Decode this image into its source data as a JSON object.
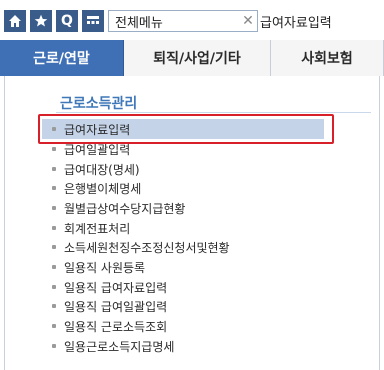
{
  "toolbar": {
    "icons": [
      "home-icon",
      "star-icon",
      "q-icon",
      "grid-icon"
    ],
    "q_label": "Q",
    "menu_tab_label": "전체메뉴",
    "close_symbol": "✕",
    "current_page": "급여자료입력"
  },
  "tabs": [
    {
      "label": "근로/연말",
      "active": true
    },
    {
      "label": "퇴직/사업/기타",
      "active": false
    },
    {
      "label": "사회보험",
      "active": false
    }
  ],
  "section": {
    "title": "근로소득관리"
  },
  "menu_items": [
    {
      "label": "급여자료입력",
      "selected": true
    },
    {
      "label": "급여일괄입력",
      "selected": false
    },
    {
      "label": "급여대장(명세)",
      "selected": false
    },
    {
      "label": "은행별이체명세",
      "selected": false
    },
    {
      "label": "월별급상여수당지급현황",
      "selected": false
    },
    {
      "label": "회계전표처리",
      "selected": false
    },
    {
      "label": "소득세원천징수조정신청서및현황",
      "selected": false
    },
    {
      "label": "일용직 사원등록",
      "selected": false
    },
    {
      "label": "일용직 급여자료입력",
      "selected": false
    },
    {
      "label": "일용직 급여일괄입력",
      "selected": false
    },
    {
      "label": "일용직 근로소득조회",
      "selected": false
    },
    {
      "label": "일용근로소득지급명세",
      "selected": false
    }
  ],
  "colors": {
    "active_tab": "#3f6fb5",
    "section_title": "#3f78b8",
    "selected_row": "#c4d3e8",
    "highlight_border": "#d8202a"
  }
}
